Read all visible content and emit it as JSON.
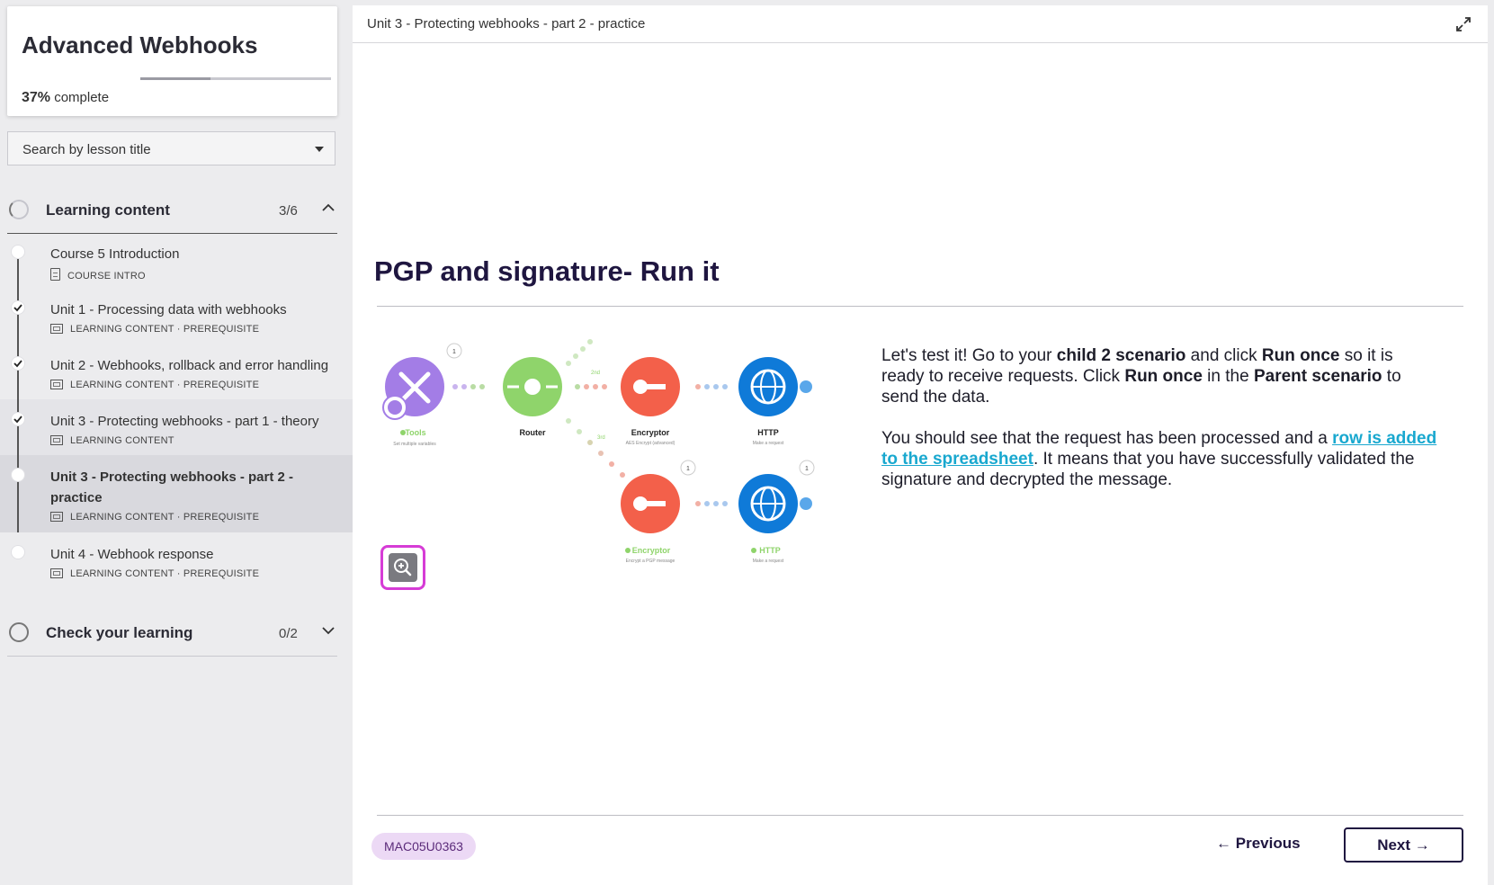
{
  "course": {
    "title": "Advanced Webhooks",
    "progress_percent": "37%",
    "progress_suffix": "complete",
    "progress_fraction": 0.37
  },
  "search": {
    "placeholder": "Search by lesson title"
  },
  "sections": [
    {
      "title": "Learning content",
      "count": "3/6",
      "expanded": true
    },
    {
      "title": "Check your learning",
      "count": "0/2",
      "expanded": false
    }
  ],
  "lessons": [
    {
      "title": "Course 5 Introduction",
      "meta": "COURSE INTRO",
      "completed": false
    },
    {
      "title": "Unit 1 - Processing data with webhooks",
      "meta": "LEARNING CONTENT · PREREQUISITE",
      "completed": true
    },
    {
      "title": "Unit 2 - Webhooks, rollback and error handling",
      "meta": "LEARNING CONTENT · PREREQUISITE",
      "completed": true
    },
    {
      "title": "Unit 3 - Protecting webhooks - part 1 - theory",
      "meta": "LEARNING CONTENT",
      "completed": true
    },
    {
      "title": "Unit 3 - Protecting webhooks - part 2 - practice",
      "meta": "LEARNING CONTENT · PREREQUISITE",
      "completed": false,
      "active": true
    },
    {
      "title": "Unit 4 - Webhook response",
      "meta": "LEARNING CONTENT · PREREQUISITE",
      "completed": false
    }
  ],
  "main": {
    "breadcrumb": "Unit 3 - Protecting webhooks - part 2 - practice",
    "heading": "PGP and signature- Run it",
    "para1": [
      "Let's test it! Go to your ",
      "child 2 scenario",
      " and click ",
      "Run once",
      " so it is ready to receive requests. Click ",
      "Run once",
      " in the ",
      "Parent scenario",
      " to send the data."
    ],
    "para2_before": "You should see that the request has been processed and a ",
    "para2_link": "row is added to the spreadsheet",
    "para2_after": ". It means that you have successfully validated the signature and decrypted the message.",
    "code": "MAC05U0363",
    "prev_label": "Previous",
    "next_label": "Next"
  },
  "diagram": {
    "tools_label": "Tools",
    "tools_sub": "Set multiple variables",
    "router_label": "Router",
    "encryptor_label": "Encryptor",
    "encryptor_sub": "AES Encrypt (advanced)",
    "http_label": "HTTP",
    "http_sub": "Make a request",
    "encryptor2_label": "Encryptor",
    "encryptor2_sub": "Encrypt a PGP message",
    "http2_label": "HTTP",
    "http2_sub": "Make a request",
    "route_2nd": "2nd",
    "route_3rd": "3rd",
    "badge_one": "1"
  },
  "colors": {
    "heading": "#1f1640",
    "link": "#19a8cf",
    "tools": "#a37de6",
    "router": "#8fd46b",
    "encryptor": "#f3604a",
    "http": "#0f7ad8",
    "zoom_border": "#d63cd6",
    "badge_bg": "#ecd9f5"
  }
}
